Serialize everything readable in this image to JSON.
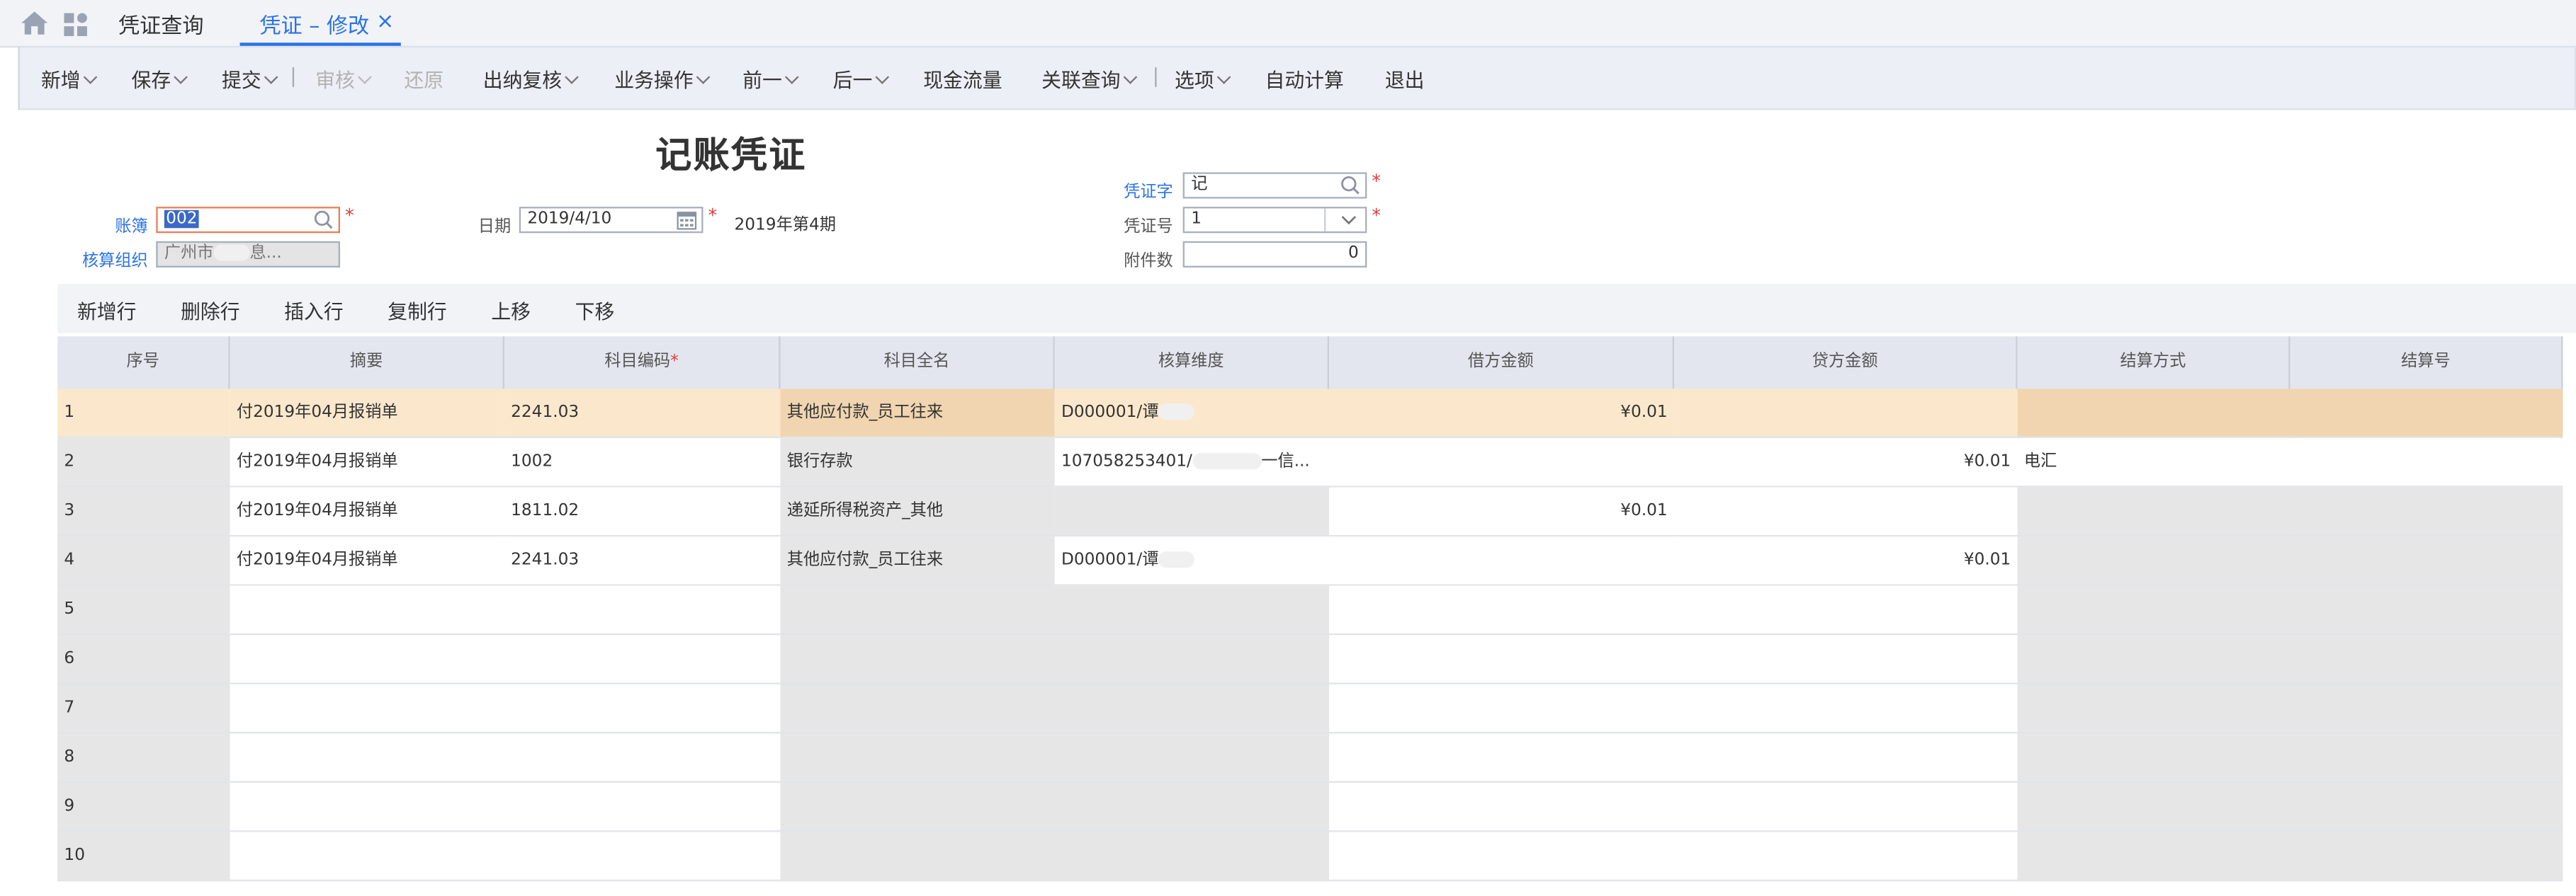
{
  "tabs": {
    "query_label": "凭证查询",
    "edit_label": "凭证 – 修改",
    "close_glyph": "×"
  },
  "toolbar": {
    "new": "新增",
    "save": "保存",
    "submit": "提交",
    "audit": "审核",
    "restore": "还原",
    "cashier_review": "出纳复核",
    "business_ops": "业务操作",
    "prev": "前一",
    "next": "后一",
    "cash_flow": "现金流量",
    "related_query": "关联查询",
    "options": "选项",
    "auto_calc": "自动计算",
    "exit": "退出"
  },
  "form": {
    "title": "记账凭证",
    "book_label": "账簿",
    "book_value": "002",
    "org_label": "核算组织",
    "org_value": "广州市",
    "org_value_tail": "息...",
    "date_label": "日期",
    "date_value": "2019/4/10",
    "period_text": "2019年第4期",
    "voucher_word_label": "凭证字",
    "voucher_word_value": "记",
    "voucher_no_label": "凭证号",
    "voucher_no_value": "1",
    "attachments_label": "附件数",
    "attachments_value": "0",
    "required_mark": "*"
  },
  "grid_toolbar": {
    "add_row": "新增行",
    "delete_row": "删除行",
    "insert_row": "插入行",
    "copy_row": "复制行",
    "move_up": "上移",
    "move_down": "下移"
  },
  "columns": {
    "seq": "序号",
    "summary": "摘要",
    "account_code": "科目编码",
    "account_name": "科目全名",
    "dimension": "核算维度",
    "debit": "借方金额",
    "credit": "贷方金额",
    "settle_method": "结算方式",
    "settle_no": "结算号"
  },
  "rows": [
    {
      "seq": "1",
      "summary": "付2019年04月报销单",
      "code": "2241.03",
      "name": "其他应付款_员工往来",
      "dim": "D000001/谭",
      "debit": "¥0.01",
      "credit": "",
      "method": "",
      "no": ""
    },
    {
      "seq": "2",
      "summary": "付2019年04月报销单",
      "code": "1002",
      "name": "银行存款",
      "dim": "107058253401/",
      "dim_tail": "一信...",
      "debit": "",
      "credit": "¥0.01",
      "method": "电汇",
      "no": ""
    },
    {
      "seq": "3",
      "summary": "付2019年04月报销单",
      "code": "1811.02",
      "name": "递延所得税资产_其他",
      "dim": "",
      "debit": "¥0.01",
      "credit": "",
      "method": "",
      "no": ""
    },
    {
      "seq": "4",
      "summary": "付2019年04月报销单",
      "code": "2241.03",
      "name": "其他应付款_员工往来",
      "dim": "D000001/谭",
      "debit": "",
      "credit": "¥0.01",
      "method": "",
      "no": ""
    },
    {
      "seq": "5"
    },
    {
      "seq": "6"
    },
    {
      "seq": "7"
    },
    {
      "seq": "8"
    },
    {
      "seq": "9"
    },
    {
      "seq": "10"
    }
  ],
  "colors": {
    "accent": "#2b73e6",
    "selected_row": "#fbe8cc",
    "required": "#e03c3c"
  }
}
